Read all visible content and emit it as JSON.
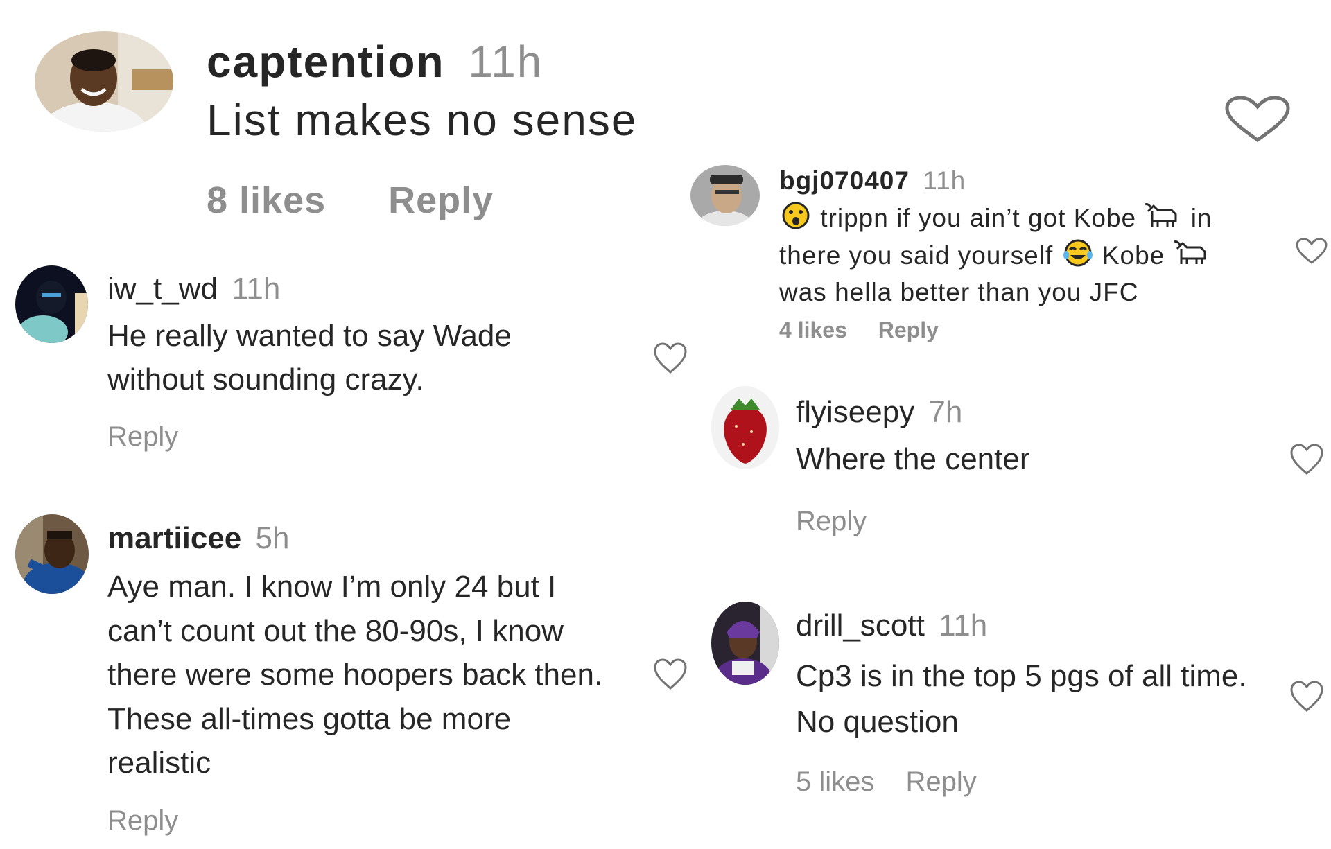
{
  "comments": [
    {
      "username": "captention",
      "time": "11h",
      "text": "List makes no sense",
      "likes": "8 likes",
      "reply": "Reply",
      "avatar_icon": "avatar-photo",
      "heart_icon": "heart-outline-icon"
    },
    {
      "username": "bgj070407",
      "time": "11h",
      "text_parts": [
        "trippn if you ain’t got Kobe",
        "in",
        "there you said yourself",
        "Kobe",
        "was hella better than you JFC"
      ],
      "emojis": [
        "astonished-face-emoji",
        "goat-emoji",
        "tears-of-joy-emoji",
        "goat-emoji"
      ],
      "likes": "4 likes",
      "reply": "Reply"
    },
    {
      "username": "iw_t_wd",
      "time": "11h",
      "text_lines": [
        "He really wanted to say Wade",
        "without sounding crazy."
      ],
      "reply": "Reply"
    },
    {
      "username": "flyiseepy",
      "time": "7h",
      "text": "Where the center",
      "reply": "Reply"
    },
    {
      "username": "martiicee",
      "time": "5h",
      "text_lines": [
        "Aye man. I know I’m only 24 but I",
        "can’t count out the 80-90s, I know",
        "there were some hoopers back then.",
        "These all-times gotta be more",
        "realistic"
      ],
      "reply": "Reply"
    },
    {
      "username": "drill_scott",
      "time": "11h",
      "text_lines": [
        "Cp3 is in the top 5 pgs of all time.",
        "No question"
      ],
      "likes": "5 likes",
      "reply": "Reply"
    }
  ],
  "colors": {
    "text": "#262626",
    "muted": "#8e8e8e",
    "heart_stroke": "#737373"
  }
}
